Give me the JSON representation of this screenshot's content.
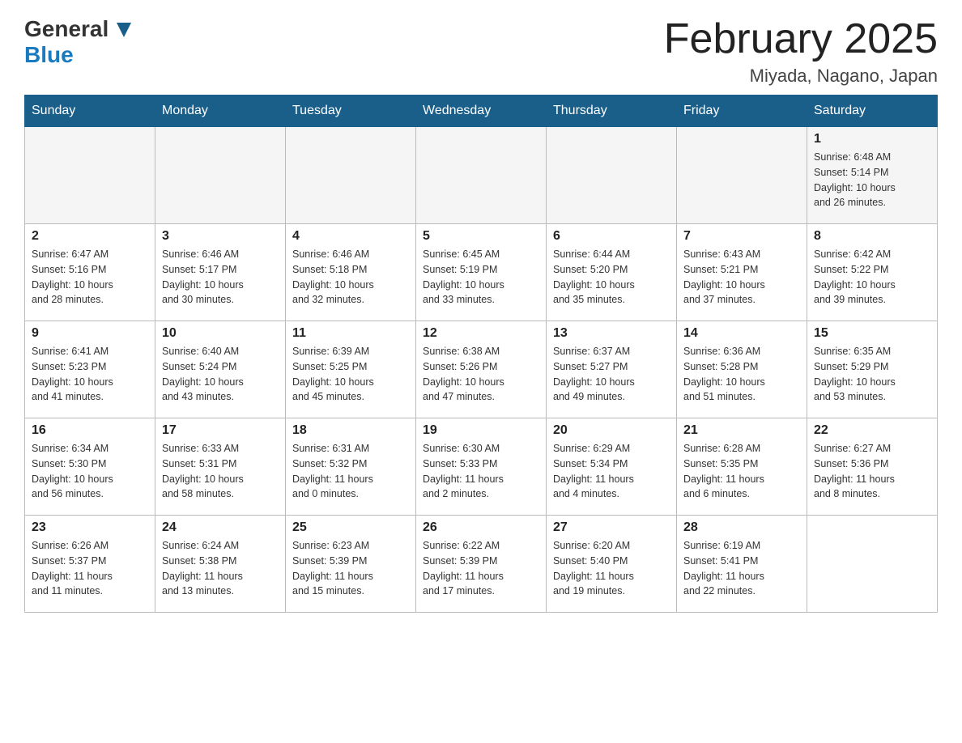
{
  "header": {
    "logo_line1": "General",
    "logo_line2": "Blue",
    "title": "February 2025",
    "subtitle": "Miyada, Nagano, Japan"
  },
  "weekdays": [
    "Sunday",
    "Monday",
    "Tuesday",
    "Wednesday",
    "Thursday",
    "Friday",
    "Saturday"
  ],
  "weeks": [
    [
      {
        "day": "",
        "info": ""
      },
      {
        "day": "",
        "info": ""
      },
      {
        "day": "",
        "info": ""
      },
      {
        "day": "",
        "info": ""
      },
      {
        "day": "",
        "info": ""
      },
      {
        "day": "",
        "info": ""
      },
      {
        "day": "1",
        "info": "Sunrise: 6:48 AM\nSunset: 5:14 PM\nDaylight: 10 hours\nand 26 minutes."
      }
    ],
    [
      {
        "day": "2",
        "info": "Sunrise: 6:47 AM\nSunset: 5:16 PM\nDaylight: 10 hours\nand 28 minutes."
      },
      {
        "day": "3",
        "info": "Sunrise: 6:46 AM\nSunset: 5:17 PM\nDaylight: 10 hours\nand 30 minutes."
      },
      {
        "day": "4",
        "info": "Sunrise: 6:46 AM\nSunset: 5:18 PM\nDaylight: 10 hours\nand 32 minutes."
      },
      {
        "day": "5",
        "info": "Sunrise: 6:45 AM\nSunset: 5:19 PM\nDaylight: 10 hours\nand 33 minutes."
      },
      {
        "day": "6",
        "info": "Sunrise: 6:44 AM\nSunset: 5:20 PM\nDaylight: 10 hours\nand 35 minutes."
      },
      {
        "day": "7",
        "info": "Sunrise: 6:43 AM\nSunset: 5:21 PM\nDaylight: 10 hours\nand 37 minutes."
      },
      {
        "day": "8",
        "info": "Sunrise: 6:42 AM\nSunset: 5:22 PM\nDaylight: 10 hours\nand 39 minutes."
      }
    ],
    [
      {
        "day": "9",
        "info": "Sunrise: 6:41 AM\nSunset: 5:23 PM\nDaylight: 10 hours\nand 41 minutes."
      },
      {
        "day": "10",
        "info": "Sunrise: 6:40 AM\nSunset: 5:24 PM\nDaylight: 10 hours\nand 43 minutes."
      },
      {
        "day": "11",
        "info": "Sunrise: 6:39 AM\nSunset: 5:25 PM\nDaylight: 10 hours\nand 45 minutes."
      },
      {
        "day": "12",
        "info": "Sunrise: 6:38 AM\nSunset: 5:26 PM\nDaylight: 10 hours\nand 47 minutes."
      },
      {
        "day": "13",
        "info": "Sunrise: 6:37 AM\nSunset: 5:27 PM\nDaylight: 10 hours\nand 49 minutes."
      },
      {
        "day": "14",
        "info": "Sunrise: 6:36 AM\nSunset: 5:28 PM\nDaylight: 10 hours\nand 51 minutes."
      },
      {
        "day": "15",
        "info": "Sunrise: 6:35 AM\nSunset: 5:29 PM\nDaylight: 10 hours\nand 53 minutes."
      }
    ],
    [
      {
        "day": "16",
        "info": "Sunrise: 6:34 AM\nSunset: 5:30 PM\nDaylight: 10 hours\nand 56 minutes."
      },
      {
        "day": "17",
        "info": "Sunrise: 6:33 AM\nSunset: 5:31 PM\nDaylight: 10 hours\nand 58 minutes."
      },
      {
        "day": "18",
        "info": "Sunrise: 6:31 AM\nSunset: 5:32 PM\nDaylight: 11 hours\nand 0 minutes."
      },
      {
        "day": "19",
        "info": "Sunrise: 6:30 AM\nSunset: 5:33 PM\nDaylight: 11 hours\nand 2 minutes."
      },
      {
        "day": "20",
        "info": "Sunrise: 6:29 AM\nSunset: 5:34 PM\nDaylight: 11 hours\nand 4 minutes."
      },
      {
        "day": "21",
        "info": "Sunrise: 6:28 AM\nSunset: 5:35 PM\nDaylight: 11 hours\nand 6 minutes."
      },
      {
        "day": "22",
        "info": "Sunrise: 6:27 AM\nSunset: 5:36 PM\nDaylight: 11 hours\nand 8 minutes."
      }
    ],
    [
      {
        "day": "23",
        "info": "Sunrise: 6:26 AM\nSunset: 5:37 PM\nDaylight: 11 hours\nand 11 minutes."
      },
      {
        "day": "24",
        "info": "Sunrise: 6:24 AM\nSunset: 5:38 PM\nDaylight: 11 hours\nand 13 minutes."
      },
      {
        "day": "25",
        "info": "Sunrise: 6:23 AM\nSunset: 5:39 PM\nDaylight: 11 hours\nand 15 minutes."
      },
      {
        "day": "26",
        "info": "Sunrise: 6:22 AM\nSunset: 5:39 PM\nDaylight: 11 hours\nand 17 minutes."
      },
      {
        "day": "27",
        "info": "Sunrise: 6:20 AM\nSunset: 5:40 PM\nDaylight: 11 hours\nand 19 minutes."
      },
      {
        "day": "28",
        "info": "Sunrise: 6:19 AM\nSunset: 5:41 PM\nDaylight: 11 hours\nand 22 minutes."
      },
      {
        "day": "",
        "info": ""
      }
    ]
  ]
}
